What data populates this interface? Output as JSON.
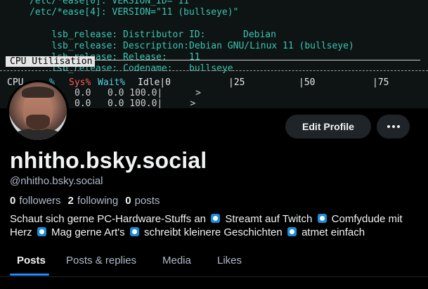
{
  "banner": {
    "terminal_lines": [
      "/etc/*ease[0]: VERSION_ID=\"11\"",
      "/etc/*ease[4]: VERSION=\"11 (bullseye)\""
    ],
    "lsb": [
      {
        "key": "lsb_release: Distributor ID:",
        "value": "Debian"
      },
      {
        "key": "lsb_release: Description:",
        "value": "Debian GNU/Linux 11 (bullseye)"
      },
      {
        "key": "lsb_release: Release:",
        "value": "11"
      },
      {
        "key": "lsb_release: Codename:",
        "value": "bullseye"
      }
    ],
    "cpu_title": "CPU Utilisation",
    "cpu_header": {
      "cpu": "CPU",
      "usr": "%",
      "sys": "Sys%",
      "wait": "Wait%",
      "idle": "Idle|0",
      "scale_25": "|25",
      "scale_50": "|50",
      "scale_75": "|75"
    },
    "cpu_rows": [
      "0.0   0.0 100.0|      >",
      "0.0   0.0 100.0|     >"
    ]
  },
  "profile": {
    "display_name": "nhitho.bsky.social",
    "handle": "@nhitho.bsky.social",
    "followers_count": "0",
    "followers_label": "followers",
    "following_count": "2",
    "following_label": "following",
    "posts_count": "0",
    "posts_label": "posts",
    "bio_segments": [
      "Schaut sich gerne PC-Hardware-Stuffs an",
      "Streamt auf Twitch",
      "Comfydude mit Herz",
      "Mag gerne Art's",
      "schreibt kleinere Geschichten",
      "atmet einfach"
    ]
  },
  "buttons": {
    "edit_profile": "Edit Profile",
    "more_icon": "ellipsis-icon"
  },
  "tabs": [
    {
      "label": "Posts",
      "active": true
    },
    {
      "label": "Posts & replies",
      "active": false
    },
    {
      "label": "Media",
      "active": false
    },
    {
      "label": "Likes",
      "active": false
    }
  ],
  "colors": {
    "background": "#000000",
    "accent": "#208bfe",
    "button_bg": "#1f2428",
    "muted_text": "#aebbc9",
    "emoji_blue": "#1a8cd8",
    "terminal_cyan": "#39c6b4"
  }
}
